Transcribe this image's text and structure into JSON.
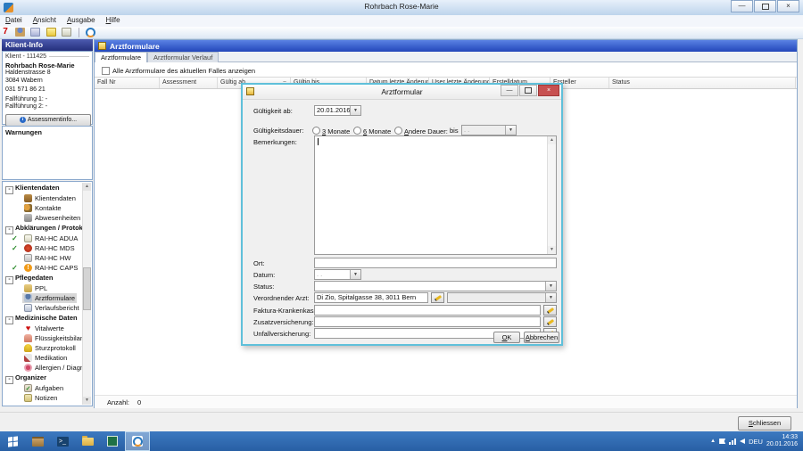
{
  "window": {
    "title": "Rohrbach Rose-Marie",
    "menu": [
      "Datei",
      "Ansicht",
      "Ausgabe",
      "Hilfe"
    ],
    "controls": {
      "minimize": "—",
      "close": "×"
    },
    "toolbar_badge": "7",
    "toolbar_icons": [
      "seven-icon",
      "person-icon",
      "report-icon",
      "note-icon",
      "edit-icon",
      "refresh-icon"
    ]
  },
  "sidebar": {
    "header": "Klient-Info",
    "client": {
      "id_label": "Klient - 111425",
      "name": "Rohrbach Rose-Marie",
      "address1": "Haldenstrasse 8",
      "address2": "3084 Wabern",
      "phone": "031 571 86 21",
      "fall1": "Fallführung 1: -",
      "fall2": "Fallführung 2: -",
      "assessment_button": "Assessmentinfo...",
      "warnings_label": "Warnungen"
    },
    "tree": [
      {
        "type": "group",
        "label": "Klientendaten"
      },
      {
        "type": "item",
        "label": "Klientendaten",
        "icon": "door"
      },
      {
        "type": "item",
        "label": "Kontakte",
        "icon": "people"
      },
      {
        "type": "item",
        "label": "Abwesenheiten",
        "icon": "exit"
      },
      {
        "type": "group",
        "label": "Abklärungen / Protokolle"
      },
      {
        "type": "item",
        "label": "RAI-HC ADUA",
        "icon": "form",
        "check": true
      },
      {
        "type": "item",
        "label": "RAI-HC MDS",
        "icon": "mds",
        "check": true
      },
      {
        "type": "item",
        "label": "RAI-HC HW",
        "icon": "hw",
        "check": false
      },
      {
        "type": "item",
        "label": "RAI-HC CAPS",
        "icon": "caps",
        "glyph": "!",
        "check": true
      },
      {
        "type": "group",
        "label": "Pflegedaten"
      },
      {
        "type": "item",
        "label": "PPL",
        "icon": "folder"
      },
      {
        "type": "item",
        "label": "Arztformulare",
        "icon": "person",
        "selected": true
      },
      {
        "type": "item",
        "label": "Verlaufsbericht",
        "icon": "docs"
      },
      {
        "type": "group",
        "label": "Medizinische Daten"
      },
      {
        "type": "item",
        "label": "Vitalwerte",
        "icon": "heart",
        "glyph": "♥"
      },
      {
        "type": "item",
        "label": "Flüssigkeitsbilanz",
        "icon": "bottle"
      },
      {
        "type": "item",
        "label": "Sturzprotokoll",
        "icon": "helmet"
      },
      {
        "type": "item",
        "label": "Medikation",
        "icon": "med"
      },
      {
        "type": "item",
        "label": "Allergien / Diagnosen...",
        "icon": "allergy"
      },
      {
        "type": "group",
        "label": "Organizer"
      },
      {
        "type": "item",
        "label": "Aufgaben",
        "icon": "tasks",
        "glyph": "✓"
      },
      {
        "type": "item",
        "label": "Notizen",
        "icon": "notes"
      }
    ]
  },
  "main": {
    "header": "Arztformulare",
    "tabs": [
      {
        "label": "Arztformulare",
        "active": true
      },
      {
        "label": "Arztformular Verlauf",
        "active": false
      }
    ],
    "filter_checkbox": "Alle Arztformulare des aktuellen Falles anzeigen",
    "table_headers": [
      "Fall Nr",
      "Assessment",
      "Gültig ab",
      "Gültig bis",
      "Datum letzte Änderung",
      "User letzte Änderung",
      "Erstelldatum",
      "Ersteller",
      "Status"
    ],
    "sort_column_index": 2,
    "sort_glyph": "−",
    "count_label": "Anzahl:",
    "count_value": "0",
    "close_button": "Schliessen"
  },
  "dialog": {
    "title": "Arztformular",
    "gueltigkeit_ab_label": "Gültigkeit ab:",
    "gueltigkeit_ab_value": "20.01.2016",
    "dauer_label": "Gültigkeitsdauer:",
    "dauer_options": [
      "3 Monate",
      "6 Monate",
      "Andere Dauer:"
    ],
    "bis_label": "bis",
    "bis_value": " .    .",
    "bemerkungen_label": "Bemerkungen:",
    "bemerkungen_value": "",
    "ort_label": "Ort:",
    "ort_value": "",
    "datum_label": "Datum:",
    "datum_value": " .    .",
    "status_label": "Status:",
    "status_value": "",
    "arzt_label": "Verordnender Arzt:",
    "arzt_value": "Di Zio, Spitalgasse 38, 3011 Bern",
    "faktura_label": "Faktura-Krankenkasse:",
    "faktura_value": "",
    "zusatz_label": "Zusatzversicherung:",
    "zusatz_value": "",
    "unfall_label": "Unfallversicherung:",
    "unfall_value": "",
    "ok_button": "OK",
    "cancel_button": "Abbrechen"
  },
  "taskbar": {
    "icons": [
      "start-icon",
      "server-manager-icon",
      "powershell-icon",
      "explorer-icon",
      "spreadsheet-icon",
      "care-app-icon"
    ],
    "tray_icons": [
      "tray-expand-icon",
      "flag-icon",
      "network-icon",
      "volume-icon"
    ],
    "language": "DEU",
    "time": "14:33",
    "date": "20.01.2016"
  },
  "colors": {
    "accent_header": "#2347ba",
    "sidebar_header": "#242f7c",
    "dialog_border": "#5fc0da",
    "close_button_red": "#c75050",
    "taskbar_blue": "#2e6bb0",
    "check_green": "#2a8a2a"
  }
}
